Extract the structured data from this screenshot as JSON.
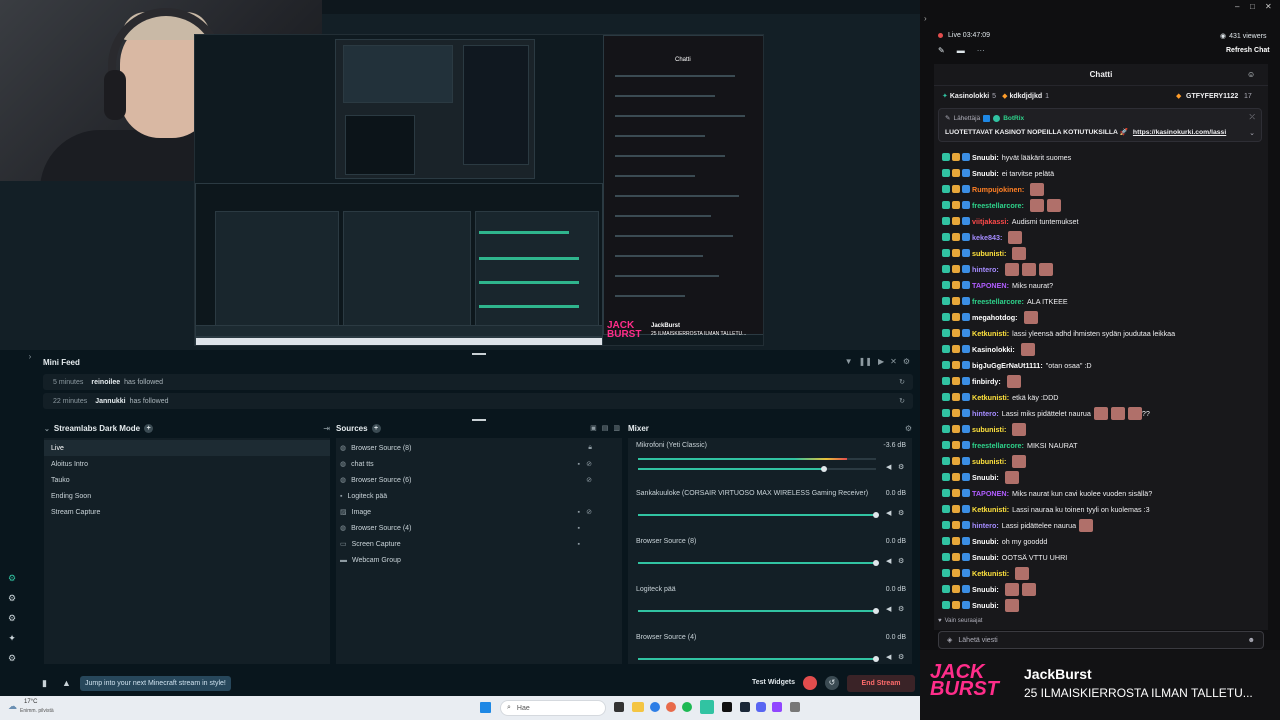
{
  "window": {
    "minimize": "–",
    "maximize": "□",
    "close": "✕"
  },
  "stream_status": {
    "live_label": "Live",
    "time": "03:47:09",
    "viewers": "431 viewers",
    "refresh": "Refresh Chat"
  },
  "preview": {
    "nested_chat_title": "Chatti",
    "nested_brand": "JackBurst",
    "nested_brand_sub": "25 ILMAISKIERROSTA ILMAN TALLETU..."
  },
  "mini_feed": {
    "title": "Mini Feed",
    "rows": [
      {
        "time": "5 minutes",
        "user": "reinoilee",
        "action": "has followed"
      },
      {
        "time": "22 minutes",
        "user": "Jannukki",
        "action": "has followed"
      }
    ]
  },
  "scenes": {
    "title": "Streamlabs Dark Mode",
    "items": [
      "Live",
      "Aloitus Intro",
      "Tauko",
      "Ending Soon",
      "Stream Capture"
    ]
  },
  "sources": {
    "title": "Sources",
    "items": [
      {
        "label": "Browser Source (8)",
        "icon": "globe-icon"
      },
      {
        "label": "chat tts",
        "icon": "globe-icon"
      },
      {
        "label": "Browser Source (6)",
        "icon": "globe-icon"
      },
      {
        "label": "Logiteck pää",
        "icon": "camera-icon"
      },
      {
        "label": "Image",
        "icon": "image-icon"
      },
      {
        "label": "Browser Source (4)",
        "icon": "globe-icon"
      },
      {
        "label": "Screen Capture",
        "icon": "monitor-icon"
      },
      {
        "label": "Webcam Group",
        "icon": "folder-icon"
      }
    ]
  },
  "mixer": {
    "title": "Mixer",
    "channels": [
      {
        "name": "Mikrofoni (Yeti Classic)",
        "db": "-3.6 dB",
        "level": 0.78
      },
      {
        "name": "Sankakuuloke (CORSAIR VIRTUOSO MAX WIRELESS Gaming Receiver)",
        "db": "0.0 dB",
        "level": 1.0
      },
      {
        "name": "Browser Source (8)",
        "db": "0.0 dB",
        "level": 1.0
      },
      {
        "name": "Logiteck pää",
        "db": "0.0 dB",
        "level": 1.0
      },
      {
        "name": "Browser Source (4)",
        "db": "0.0 dB",
        "level": 1.0
      }
    ]
  },
  "bottom": {
    "promo": "Jump into your next Minecraft stream in style!",
    "test_widgets": "Test Widgets",
    "end_stream": "End Stream"
  },
  "taskbar": {
    "weather_temp": "17°C",
    "weather_desc": "Enimm. pilvistä",
    "search": "Hae"
  },
  "chat": {
    "title": "Chatti",
    "leaders": [
      {
        "name": "Kasinolokki",
        "count": "5"
      },
      {
        "name": "kdkdjdjkd",
        "count": "1"
      },
      {
        "name": "GTFYFERY1122",
        "count": "17"
      }
    ],
    "pinned_by_label": "Lähettäjä",
    "pinned_by": "BotRix",
    "pinned_text": "LUOTETTAVAT KASINOT NOPEILLA KOTIUTUKSILLA 🚀",
    "pinned_link": "https://kasinokurki.com/lassi",
    "messages": [
      {
        "user": "Snuubi",
        "color": "#ffffff",
        "text": "hyvät lääkärit suomes",
        "emotes": 0
      },
      {
        "user": "Snuubi",
        "color": "#ffffff",
        "text": "ei tarvitse pelätä",
        "emotes": 0
      },
      {
        "user": "Rumpujokinen",
        "color": "#ff7f24",
        "text": "",
        "emotes": 1
      },
      {
        "user": "freestellarcore",
        "color": "#2ed38b",
        "text": "",
        "emotes": 2
      },
      {
        "user": "viitjakassi",
        "color": "#ff4a4a",
        "text": "Audismi tuntemukset",
        "emotes": 0
      },
      {
        "user": "keke843",
        "color": "#a58cff",
        "text": "",
        "emotes": 1
      },
      {
        "user": "subunisti",
        "color": "#ffe23d",
        "text": "",
        "emotes": 1
      },
      {
        "user": "hintero",
        "color": "#a58cff",
        "text": "",
        "emotes": 3
      },
      {
        "user": "TAPONEN",
        "color": "#b05cff",
        "text": "Miks naurat?",
        "emotes": 0
      },
      {
        "user": "freestellarcore",
        "color": "#2ed38b",
        "text": "ALA ITKEEE",
        "emotes": 0
      },
      {
        "user": "megahotdog",
        "color": "#ffffff",
        "text": "",
        "emotes": 1
      },
      {
        "user": "Ketkunisti",
        "color": "#ffe23d",
        "text": "lassi yleensä adhd ihmisten sydän joudutaa leikkaa",
        "emotes": 0
      },
      {
        "user": "Kasinolokki",
        "color": "#ffffff",
        "text": "",
        "emotes": 1
      },
      {
        "user": "bigJuGgErNaUt1111",
        "color": "#ffffff",
        "text": "\"otan osaa\" :D",
        "emotes": 0
      },
      {
        "user": "finbirdy",
        "color": "#ffffff",
        "text": "",
        "emotes": 1
      },
      {
        "user": "Ketkunisti",
        "color": "#ffe23d",
        "text": "etkä käy :DDD",
        "emotes": 0
      },
      {
        "user": "hintero",
        "color": "#a58cff",
        "text": "Lassi miks pidättelet naurua",
        "emotes": 3,
        "suffix": "??"
      },
      {
        "user": "subunisti",
        "color": "#ffe23d",
        "text": "",
        "emotes": 1
      },
      {
        "user": "freestellarcore",
        "color": "#2ed38b",
        "text": "MIKSI NAURAT",
        "emotes": 0
      },
      {
        "user": "subunisti",
        "color": "#ffe23d",
        "text": "",
        "emotes": 1
      },
      {
        "user": "Snuubi",
        "color": "#ffffff",
        "text": "",
        "emotes": 1
      },
      {
        "user": "TAPONEN",
        "color": "#b05cff",
        "text": "Miks naurat kun cavi kuolee vuoden sisällä?",
        "emotes": 0
      },
      {
        "user": "Ketkunisti",
        "color": "#ffe23d",
        "text": "Lassi nauraa ku toinen tyyli on kuolemas :3",
        "emotes": 0
      },
      {
        "user": "hintero",
        "color": "#a58cff",
        "text": "Lassi pidättelee naurua",
        "emotes": 1
      },
      {
        "user": "Snuubi",
        "color": "#ffffff",
        "text": "oh my gooddd",
        "emotes": 0
      },
      {
        "user": "Snuubi",
        "color": "#ffffff",
        "text": "OOTSÄ VTTU UHRI",
        "emotes": 0
      },
      {
        "user": "Ketkunisti",
        "color": "#ffe23d",
        "text": "",
        "emotes": 1
      },
      {
        "user": "Snuubi",
        "color": "#ffffff",
        "text": "",
        "emotes": 2
      },
      {
        "user": "Snuubi",
        "color": "#ffffff",
        "text": "",
        "emotes": 1
      }
    ],
    "followers_only": "Vain seuraajat",
    "input_placeholder": "Lähetä viesti"
  },
  "banner": {
    "logo_top": "JACK",
    "logo_bottom": "BURST",
    "name": "JackBurst",
    "sub": "25 ILMAISKIERROSTA ILMAN TALLETU..."
  },
  "colors": {
    "accent": "#31c3a2",
    "live_red": "#e24d4d",
    "brand_pink": "#ff2d8a"
  }
}
